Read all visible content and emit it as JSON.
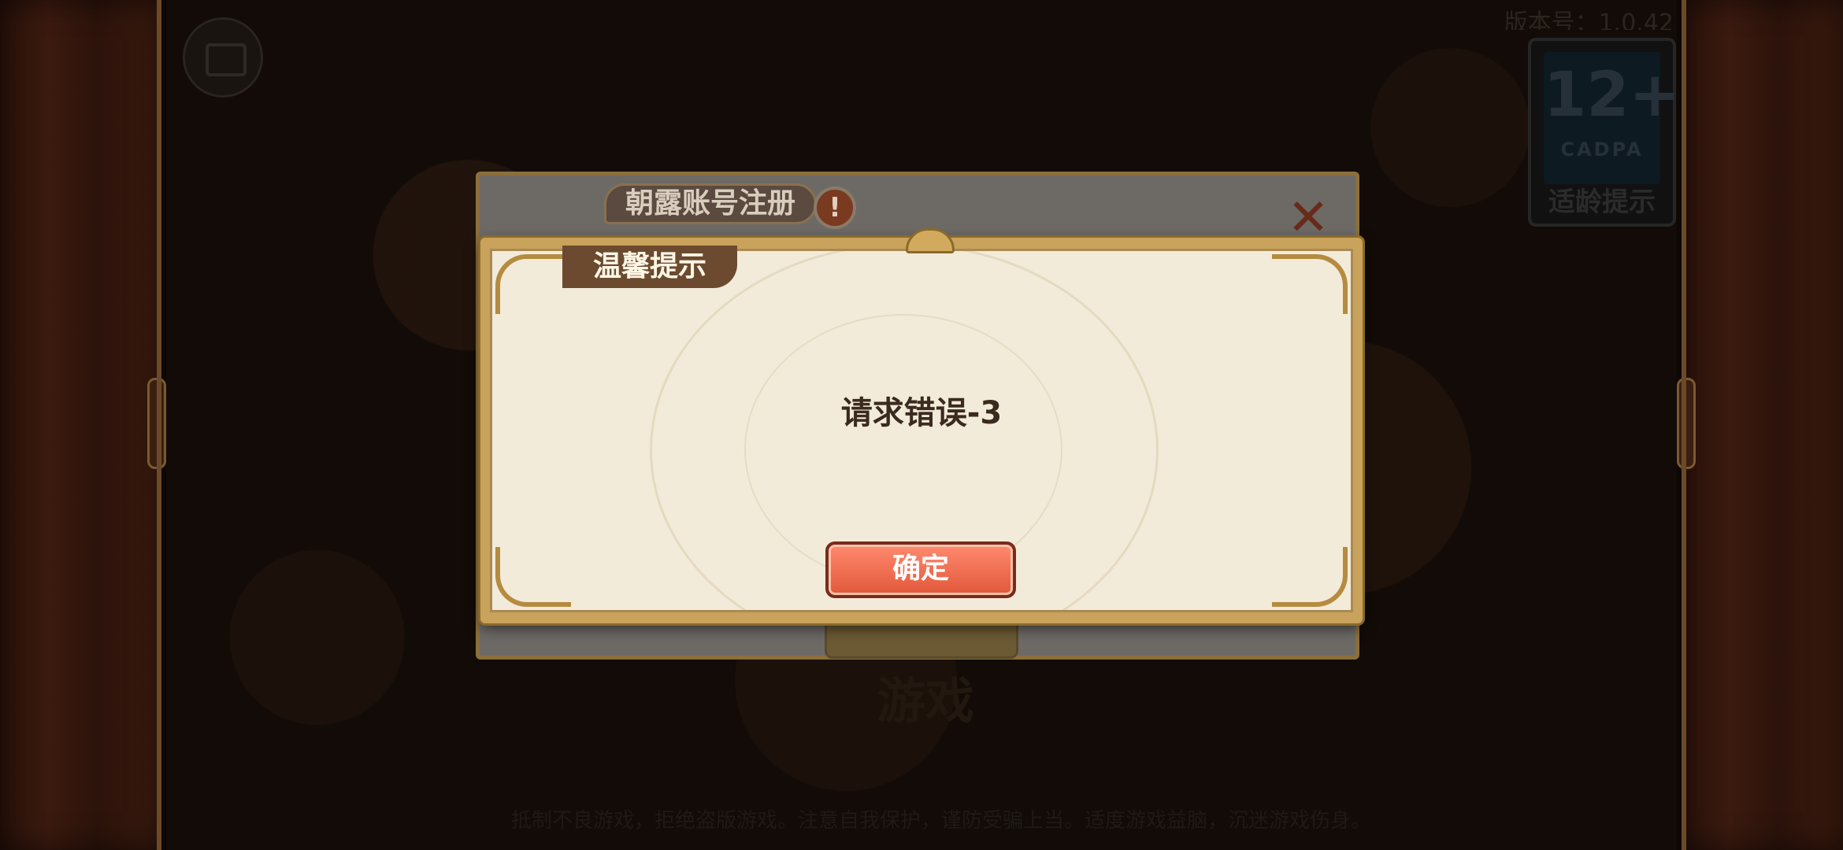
{
  "background": {
    "top_right_text": "版本号：1.0.42",
    "age_rating": {
      "number": "12+",
      "org": "CADPA",
      "label": "适龄提示"
    },
    "logo_text": "游戏",
    "footer_text": "抵制不良游戏，拒绝盗版游戏。注意自我保护，谨防受骗上当。适度游戏益脑，沉迷游戏伤身。"
  },
  "register_dialog": {
    "title": "朝露账号注册",
    "warning_glyph": "!",
    "close_glyph": "✕"
  },
  "tip_dialog": {
    "title": "温馨提示",
    "message": "请求错误-3",
    "confirm_label": "确定"
  },
  "colors": {
    "accent_gold": "#c9a25c",
    "confirm_red": "#e2573a",
    "panel_bg": "#f3ebd9"
  }
}
